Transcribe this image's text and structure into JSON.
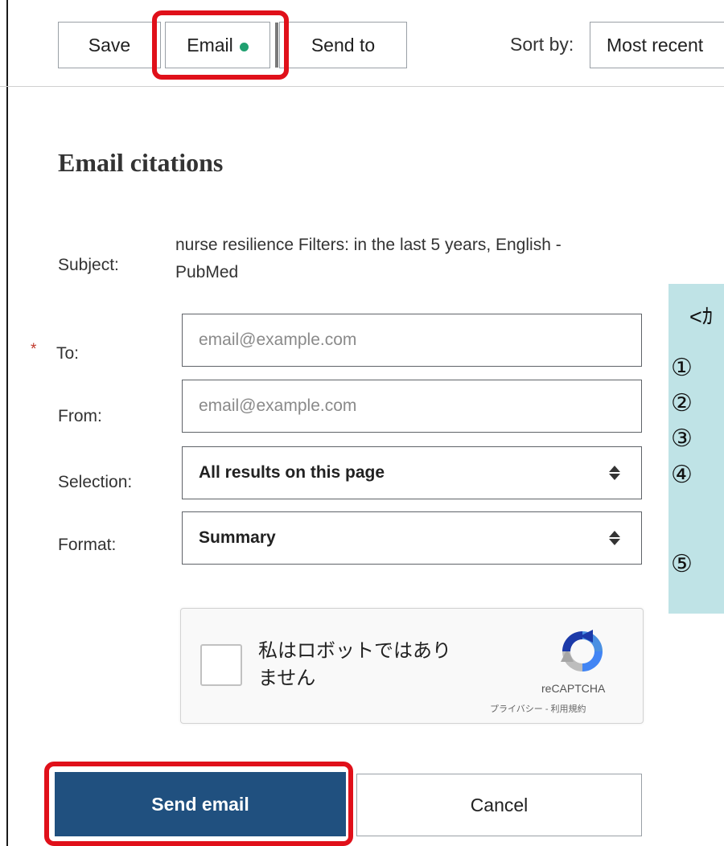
{
  "toolbar": {
    "save_label": "Save",
    "email_label": "Email",
    "send_to_label": "Send to",
    "sort_label": "Sort by:",
    "sort_value": "Most recent"
  },
  "form": {
    "heading": "Email citations",
    "subject_label": "Subject:",
    "subject_value": "nurse resilience Filters: in the last 5 years, English - PubMed",
    "required_mark": "*",
    "to_label": "To:",
    "to_placeholder": "email@example.com",
    "to_value": "",
    "from_label": "From:",
    "from_placeholder": "email@example.com",
    "from_value": "",
    "selection_label": "Selection:",
    "selection_value": "All results on this page",
    "format_label": "Format:",
    "format_value": "Summary"
  },
  "captcha": {
    "line1": "私はロボットではあり",
    "line2": "ません",
    "brand": "reCAPTCHA",
    "privacy": "プライバシー - 利用規約"
  },
  "actions": {
    "send_label": "Send email",
    "cancel_label": "Cancel"
  },
  "annotation_box": {
    "title": "<ｶ",
    "numbers": [
      "①",
      "②",
      "③",
      "④",
      "⑤"
    ]
  },
  "colors": {
    "highlight": "#e0101a",
    "primary_button": "#20507f",
    "status_dot": "#20a070",
    "annotation_bg": "#bfe3e6"
  }
}
